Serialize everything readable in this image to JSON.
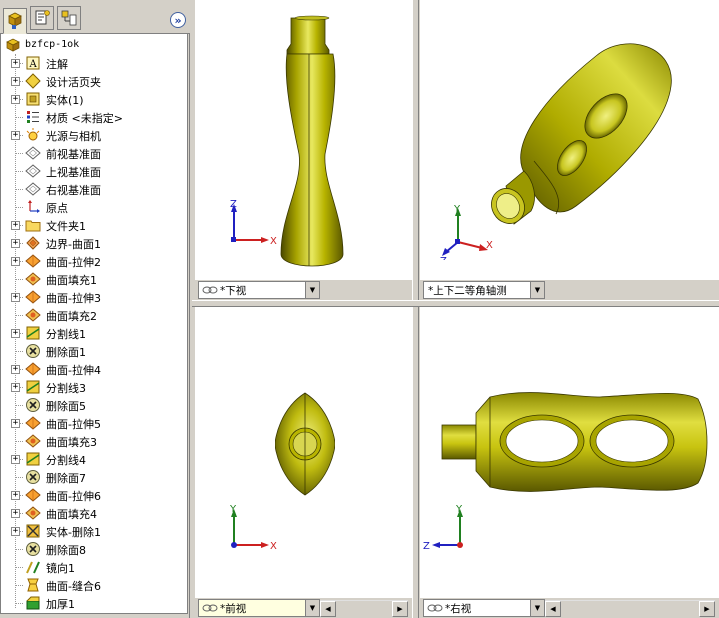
{
  "panel": {
    "tabs": [
      {
        "name": "feature-manager-tab",
        "icon": "feature-tree-icon"
      },
      {
        "name": "property-manager-tab",
        "icon": "property-manager-icon"
      },
      {
        "name": "configuration-manager-tab",
        "icon": "configuration-manager-icon"
      }
    ],
    "expand_glyph": "»",
    "root": {
      "label": "bzfcp-1ok",
      "icon": "part-icon"
    },
    "items": [
      {
        "label": "注解",
        "icon": "annotation-icon",
        "expandable": true
      },
      {
        "label": "设计活页夹",
        "icon": "design-binder-icon",
        "expandable": true
      },
      {
        "label": "实体(1)",
        "icon": "solid-bodies-icon",
        "expandable": true
      },
      {
        "label": "材质 <未指定>",
        "icon": "material-icon",
        "expandable": false
      },
      {
        "label": "光源与相机",
        "icon": "lights-camera-icon",
        "expandable": true
      },
      {
        "label": "前视基准面",
        "icon": "plane-icon",
        "expandable": false
      },
      {
        "label": "上视基准面",
        "icon": "plane-icon",
        "expandable": false
      },
      {
        "label": "右视基准面",
        "icon": "plane-icon",
        "expandable": false
      },
      {
        "label": "原点",
        "icon": "origin-icon",
        "expandable": false
      },
      {
        "label": "文件夹1",
        "icon": "folder-icon",
        "expandable": true
      },
      {
        "label": "边界-曲面1",
        "icon": "boundary-surface-icon",
        "expandable": true
      },
      {
        "label": "曲面-拉伸2",
        "icon": "extruded-surface-icon",
        "expandable": true
      },
      {
        "label": "曲面填充1",
        "icon": "filled-surface-icon",
        "expandable": false
      },
      {
        "label": "曲面-拉伸3",
        "icon": "extruded-surface-icon",
        "expandable": true
      },
      {
        "label": "曲面填充2",
        "icon": "filled-surface-icon",
        "expandable": false
      },
      {
        "label": "分割线1",
        "icon": "split-line-icon",
        "expandable": true
      },
      {
        "label": "删除面1",
        "icon": "delete-face-icon",
        "expandable": false
      },
      {
        "label": "曲面-拉伸4",
        "icon": "extruded-surface-icon",
        "expandable": true
      },
      {
        "label": "分割线3",
        "icon": "split-line-icon",
        "expandable": true
      },
      {
        "label": "删除面5",
        "icon": "delete-face-icon",
        "expandable": false
      },
      {
        "label": "曲面-拉伸5",
        "icon": "extruded-surface-icon",
        "expandable": true
      },
      {
        "label": "曲面填充3",
        "icon": "filled-surface-icon",
        "expandable": false
      },
      {
        "label": "分割线4",
        "icon": "split-line-icon",
        "expandable": true
      },
      {
        "label": "删除面7",
        "icon": "delete-face-icon",
        "expandable": false
      },
      {
        "label": "曲面-拉伸6",
        "icon": "extruded-surface-icon",
        "expandable": true
      },
      {
        "label": "曲面填充4",
        "icon": "filled-surface-icon",
        "expandable": true
      },
      {
        "label": "实体-删除1",
        "icon": "delete-body-icon",
        "expandable": true
      },
      {
        "label": "删除面8",
        "icon": "delete-face-icon",
        "expandable": false
      },
      {
        "label": "镜向1",
        "icon": "mirror-icon",
        "expandable": false
      },
      {
        "label": "曲面-缝合6",
        "icon": "knit-surface-icon",
        "expandable": false
      },
      {
        "label": "加厚1",
        "icon": "thicken-icon",
        "expandable": false
      }
    ]
  },
  "viewports": {
    "top_left": {
      "view_name": "*下视",
      "axes": [
        "Z",
        "X"
      ]
    },
    "top_right": {
      "view_name": "*上下二等角轴测",
      "axes": [
        "Y",
        "X",
        "Z"
      ]
    },
    "bottom_left": {
      "view_name": "*前视",
      "axes": [
        "Y",
        "X"
      ]
    },
    "bottom_right": {
      "view_name": "*右视",
      "axes": [
        "Y",
        "Z"
      ]
    }
  },
  "colors": {
    "model_fill": "#b3b000",
    "model_dark": "#5a5800",
    "model_highlight": "#eef07a",
    "axis_x": "#cc2020",
    "axis_y": "#208020",
    "axis_z": "#2020c0"
  }
}
